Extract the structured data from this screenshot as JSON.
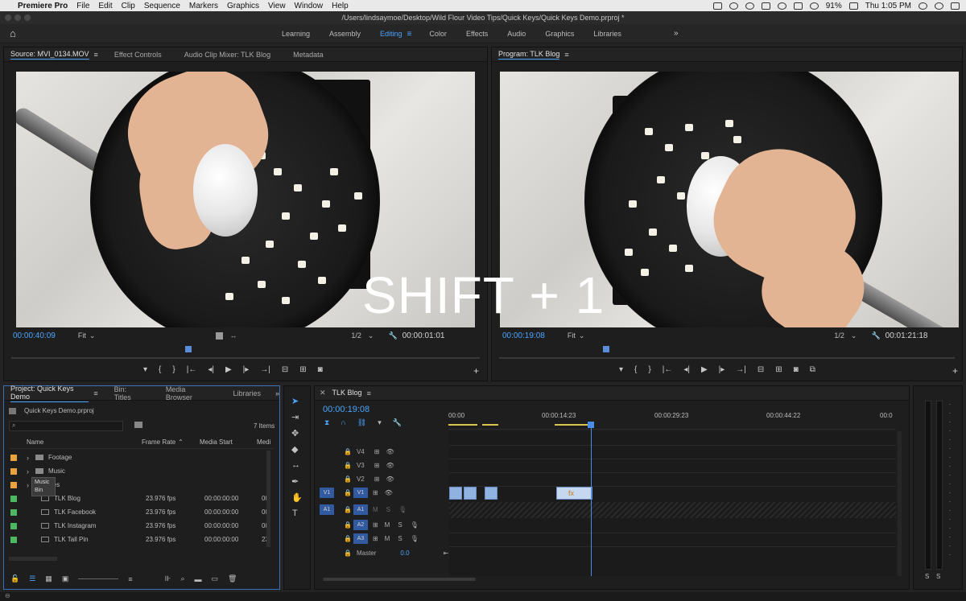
{
  "menubar": {
    "app": "Premiere Pro",
    "items": [
      "File",
      "Edit",
      "Clip",
      "Sequence",
      "Markers",
      "Graphics",
      "View",
      "Window",
      "Help"
    ],
    "battery": "91%",
    "clock": "Thu 1:05 PM"
  },
  "window": {
    "title": "/Users/lindsaymoe/Desktop/Wild Flour Video Tips/Quick Keys/Quick Keys Demo.prproj *"
  },
  "workspaces": {
    "tabs": [
      "Learning",
      "Assembly",
      "Editing",
      "Color",
      "Effects",
      "Audio",
      "Graphics",
      "Libraries"
    ],
    "active": "Editing"
  },
  "source_monitor": {
    "tabs": [
      "Source: MVI_0134.MOV",
      "Effect Controls",
      "Audio Clip Mixer: TLK Blog",
      "Metadata"
    ],
    "timecode": "00:00:40:09",
    "fit": "Fit",
    "resolution": "1/2",
    "duration": "00:00:01:01"
  },
  "program_monitor": {
    "tab": "Program: TLK Blog",
    "timecode": "00:00:19:08",
    "fit": "Fit",
    "resolution": "1/2",
    "duration": "00:01:21:18"
  },
  "overlay": {
    "text": "SHIFT + 1"
  },
  "project": {
    "tabs": [
      "Project: Quick Keys Demo",
      "Bin: Titles",
      "Media Browser",
      "Libraries"
    ],
    "file": "Quick Keys Demo.prproj",
    "item_count": "7 Items",
    "columns": {
      "name": "Name",
      "frame_rate": "Frame Rate",
      "media_start": "Media Start",
      "media_end": "Medi"
    },
    "rows": [
      {
        "name": "Footage",
        "color": "#e8a33c",
        "type": "bin",
        "fps": "",
        "start": "",
        "end": ""
      },
      {
        "name": "Music",
        "color": "#e8a33c",
        "type": "bin",
        "fps": "",
        "start": "",
        "end": ""
      },
      {
        "name": "itles",
        "color": "#e8a33c",
        "type": "bin",
        "fps": "",
        "start": "",
        "end": ""
      },
      {
        "name": "TLK Blog",
        "color": "#4db862",
        "type": "seq",
        "fps": "23.976 fps",
        "start": "00:00:00:00",
        "end": "00"
      },
      {
        "name": "TLK Facebook",
        "color": "#4db862",
        "type": "seq",
        "fps": "23.976 fps",
        "start": "00:00:00:00",
        "end": "00"
      },
      {
        "name": "TLK Instagram",
        "color": "#4db862",
        "type": "seq",
        "fps": "23.976 fps",
        "start": "00:00:00:00",
        "end": "00"
      },
      {
        "name": "TLK Tall Pin",
        "color": "#4db862",
        "type": "seq",
        "fps": "23.976 fps",
        "start": "00:00:00:00",
        "end": "23"
      }
    ],
    "tooltip": [
      "Music",
      "Bin"
    ]
  },
  "timeline": {
    "tab": "TLK Blog",
    "timecode": "00:00:19:08",
    "ruler": [
      "00:00",
      "00:00:14:23",
      "00:00:29:23",
      "00:00:44:22",
      "00:0"
    ],
    "tracks": [
      {
        "label": "V4",
        "src": ""
      },
      {
        "label": "V3",
        "src": ""
      },
      {
        "label": "V2",
        "src": ""
      },
      {
        "label": "V1",
        "src": "V1"
      },
      {
        "label": "A1",
        "src": "A1"
      },
      {
        "label": "A2",
        "src": ""
      },
      {
        "label": "A3",
        "src": ""
      }
    ],
    "master": "Master",
    "master_value": "0.0",
    "mute": "M",
    "solo": "S"
  },
  "meters": {
    "s1": "S",
    "s2": "S"
  }
}
